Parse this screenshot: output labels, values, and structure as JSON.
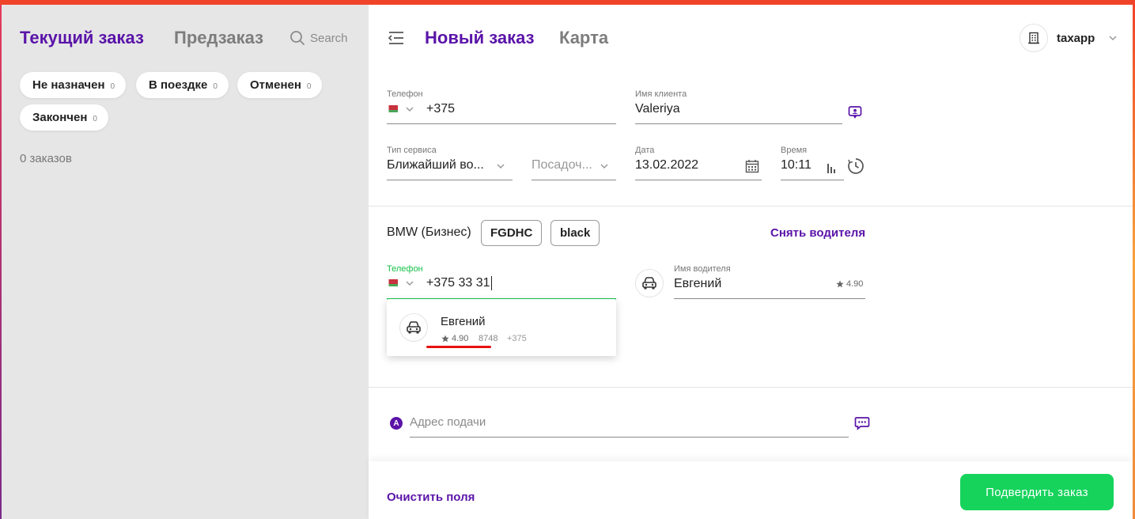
{
  "left_panel": {
    "tabs": {
      "current": "Текущий заказ",
      "preorder": "Предзаказ"
    },
    "search": {
      "placeholder": "Search"
    },
    "filters": [
      {
        "label": "Не назначен",
        "count": "0"
      },
      {
        "label": "В поездке",
        "count": "0"
      },
      {
        "label": "Отменен",
        "count": "0"
      },
      {
        "label": "Закончен",
        "count": "0"
      }
    ],
    "orders_count": "0 заказов"
  },
  "header": {
    "new_order": "Новый заказ",
    "map": "Карта",
    "account": "taxapp"
  },
  "client": {
    "phone_label": "Телефон",
    "phone_value": "+375",
    "name_label": "Имя клиента",
    "name_value": "Valeriya"
  },
  "service": {
    "type_label": "Тип сервиса",
    "type_value": "Ближайший во...",
    "boarding_placeholder": "Посадоч...",
    "date_label": "Дата",
    "date_value": "13.02.2022",
    "time_label": "Время",
    "time_value": "10:11"
  },
  "driver": {
    "car_model": "BMW (Бизнес)",
    "plate": "FGDHC",
    "color": "black",
    "remove_label": "Снять водителя",
    "phone_label": "Телефон",
    "phone_value": "+375 33 31",
    "name_label": "Имя водителя",
    "name_value": "Евгений",
    "rating": "4.90"
  },
  "suggestion": {
    "name": "Евгений",
    "rating": "4.90",
    "code": "8748",
    "phone": "+375"
  },
  "address": {
    "marker": "A",
    "placeholder": "Адрес подачи"
  },
  "footer": {
    "clear_label": "Очистить поля",
    "confirm_label": "Подвердить заказ"
  },
  "colors": {
    "accent": "#5a14a8",
    "confirm": "#16d35c",
    "top_bar": "#f0442a",
    "active_label": "#16c24a",
    "highlight": "#e81010"
  },
  "icons": [
    "search-icon",
    "menu-collapse-icon",
    "building-icon",
    "chevron-down-icon",
    "belarus-flag-icon",
    "contact-card-icon",
    "calendar-icon",
    "time-picker-icon",
    "clock-history-icon",
    "car-icon",
    "star-icon",
    "chat-icon"
  ]
}
